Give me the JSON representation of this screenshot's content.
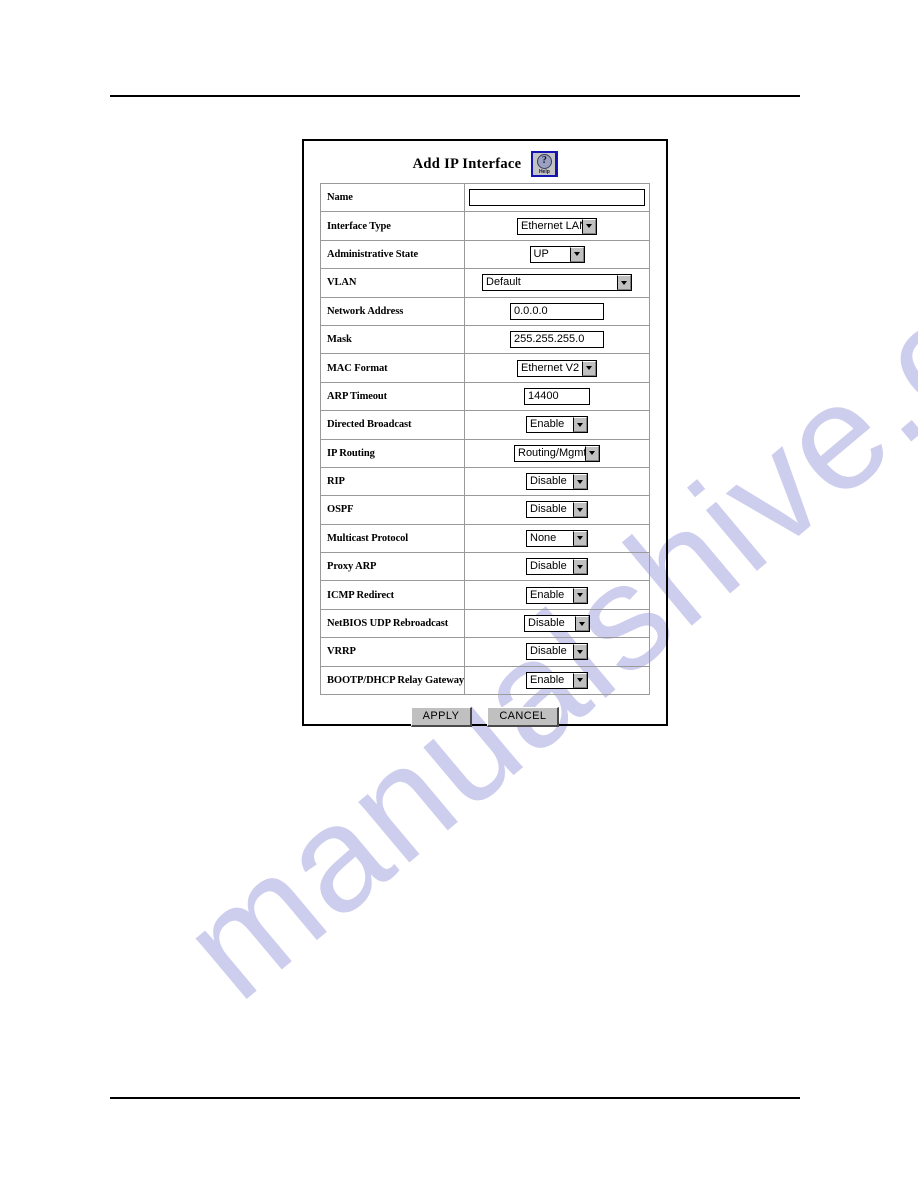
{
  "page": {
    "rules": {
      "top_label": "header-rule",
      "bottom_label": "footer-rule"
    },
    "watermark": {
      "text": "manualshive.com",
      "color": "#cdcdee"
    }
  },
  "dialog": {
    "title": "Add IP Interface",
    "help_button": {
      "glyph": "?",
      "label": "Help",
      "name": "help-icon"
    },
    "rows": [
      {
        "label": "Name",
        "widget": "text",
        "value": "",
        "width": "wide"
      },
      {
        "label": "Interface Type",
        "widget": "dropdown",
        "value": "Ethernet LAN",
        "width": "dd-w80"
      },
      {
        "label": "Administrative State",
        "widget": "dropdown",
        "value": "UP",
        "width": "dd-w55"
      },
      {
        "label": "VLAN",
        "widget": "dropdown",
        "value": "Default",
        "width": "dd-w150"
      },
      {
        "label": "Network Address",
        "widget": "text",
        "value": "0.0.0.0",
        "width": "addr"
      },
      {
        "label": "Mask",
        "widget": "text",
        "value": "255.255.255.0",
        "width": "mask"
      },
      {
        "label": "MAC Format",
        "widget": "dropdown",
        "value": "Ethernet V2",
        "width": "dd-w80"
      },
      {
        "label": "ARP Timeout",
        "widget": "text",
        "value": "14400",
        "width": "arp"
      },
      {
        "label": "Directed Broadcast",
        "widget": "dropdown",
        "value": "Enable",
        "width": "dd-w62"
      },
      {
        "label": "IP Routing",
        "widget": "dropdown",
        "value": "Routing/Mgmt",
        "width": "dd-w86"
      },
      {
        "label": "RIP",
        "widget": "dropdown",
        "value": "Disable",
        "width": "dd-w62"
      },
      {
        "label": "OSPF",
        "widget": "dropdown",
        "value": "Disable",
        "width": "dd-w62"
      },
      {
        "label": "Multicast Protocol",
        "widget": "dropdown",
        "value": "None",
        "width": "dd-w62"
      },
      {
        "label": "Proxy ARP",
        "widget": "dropdown",
        "value": "Disable",
        "width": "dd-w62"
      },
      {
        "label": "ICMP Redirect",
        "widget": "dropdown",
        "value": "Enable",
        "width": "dd-w62"
      },
      {
        "label": "NetBIOS UDP Rebroadcast",
        "widget": "dropdown",
        "value": "Disable",
        "width": "dd-w66"
      },
      {
        "label": "VRRP",
        "widget": "dropdown",
        "value": "Disable",
        "width": "dd-w62"
      },
      {
        "label": "BOOTP/DHCP Relay Gateway",
        "widget": "dropdown",
        "value": "Enable",
        "width": "dd-w62"
      }
    ],
    "buttons": {
      "apply": "APPLY",
      "cancel": "CANCEL"
    }
  }
}
